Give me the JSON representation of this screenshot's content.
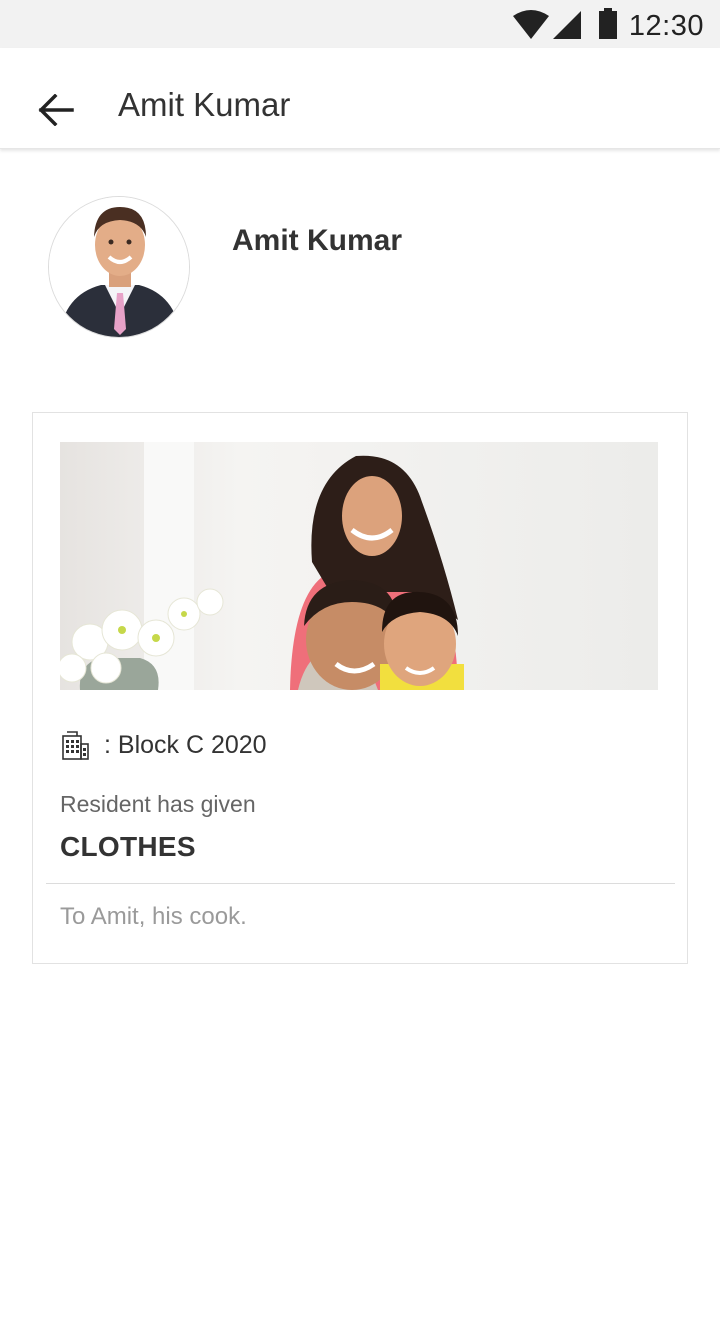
{
  "status_bar": {
    "time": "12:30",
    "icons": [
      "wifi-icon",
      "cellular-signal-icon",
      "battery-icon"
    ]
  },
  "app_bar": {
    "title": "Amit Kumar",
    "back_icon": "arrow-left-icon"
  },
  "profile": {
    "name": "Amit Kumar"
  },
  "card": {
    "block_icon": "building-icon",
    "block_label": ": Block C 2020",
    "given_label": "Resident has given",
    "item": "CLOTHES",
    "note": "To Amit, his cook."
  },
  "colors": {
    "status_bar_bg": "#f2f2f2",
    "text_primary": "#333333",
    "text_secondary": "#666666",
    "text_hint": "#9a9a9a",
    "border": "#e2e2e2"
  }
}
